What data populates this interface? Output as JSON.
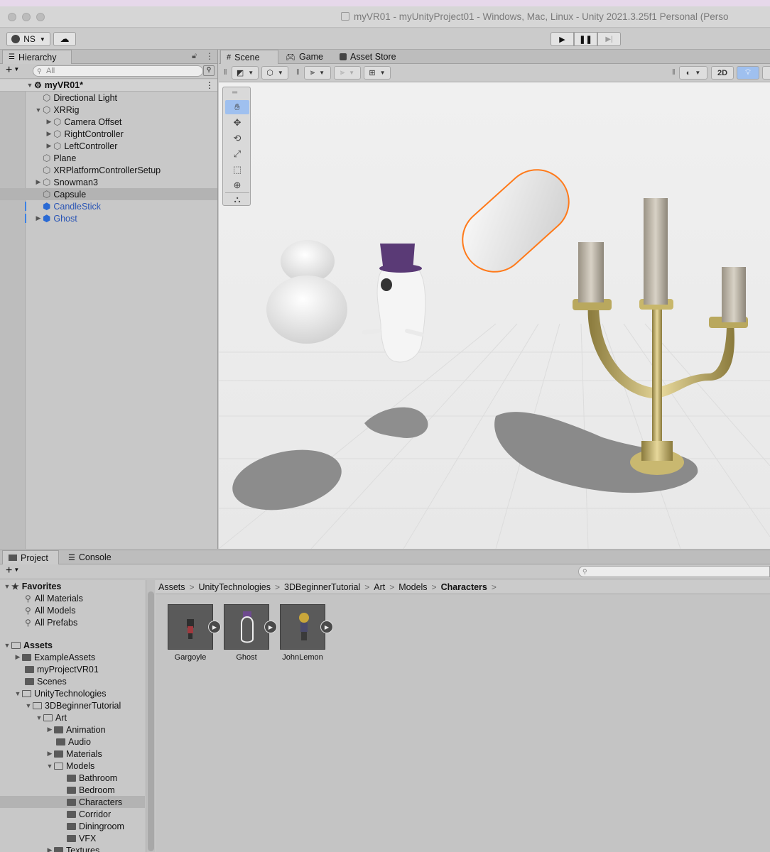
{
  "window": {
    "title": "myVR01 - myUnityProject01 - Windows, Mac, Linux - Unity 2021.3.25f1 Personal (Perso"
  },
  "toolbar": {
    "account_label": "NS"
  },
  "hierarchy": {
    "tab_label": "Hierarchy",
    "search_placeholder": "All",
    "scene_name": "myVR01*",
    "items": [
      {
        "label": "Directional Light"
      },
      {
        "label": "XRRig"
      },
      {
        "label": "Camera Offset"
      },
      {
        "label": "RightController"
      },
      {
        "label": "LeftController"
      },
      {
        "label": "Plane"
      },
      {
        "label": "XRPlatformControllerSetup"
      },
      {
        "label": "Snowman3"
      },
      {
        "label": "Capsule"
      },
      {
        "label": "CandleStick"
      },
      {
        "label": "Ghost"
      }
    ]
  },
  "scene_view": {
    "tabs": [
      {
        "label": "Scene"
      },
      {
        "label": "Game"
      },
      {
        "label": "Asset Store"
      }
    ],
    "mode_2d_label": "2D"
  },
  "project": {
    "tabs": [
      {
        "label": "Project"
      },
      {
        "label": "Console"
      }
    ],
    "favorites": {
      "label": "Favorites",
      "items": [
        "All Materials",
        "All Models",
        "All Prefabs"
      ]
    },
    "tree": {
      "assets": "Assets",
      "example_assets": "ExampleAssets",
      "my_project": "myProjectVR01",
      "scenes": "Scenes",
      "unity_tech": "UnityTechnologies",
      "beginner": "3DBeginnerTutorial",
      "art": "Art",
      "animation": "Animation",
      "audio": "Audio",
      "materials": "Materials",
      "models": "Models",
      "bathroom": "Bathroom",
      "bedroom": "Bedroom",
      "characters": "Characters",
      "corridor": "Corridor",
      "diningroom": "Diningroom",
      "vfx": "VFX",
      "textures": "Textures"
    },
    "breadcrumb": [
      "Assets",
      "UnityTechnologies",
      "3DBeginnerTutorial",
      "Art",
      "Models",
      "Characters"
    ],
    "assets": [
      {
        "label": "Gargoyle"
      },
      {
        "label": "Ghost"
      },
      {
        "label": "JohnLemon"
      }
    ]
  }
}
